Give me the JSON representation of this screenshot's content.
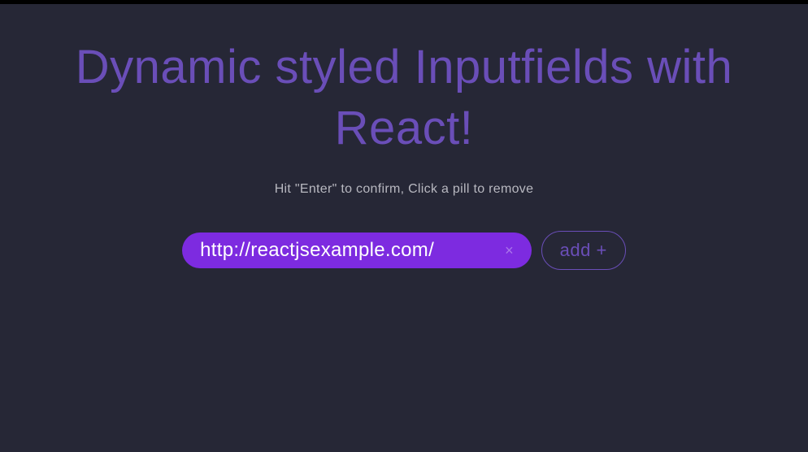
{
  "title": "Dynamic styled Inputfields with React!",
  "subtitle": "Hit \"Enter\" to confirm, Click a pill to remove",
  "pill": {
    "value": "http://reactjsexample.com/",
    "remove_label": "×"
  },
  "add_button": {
    "label": "add +"
  }
}
